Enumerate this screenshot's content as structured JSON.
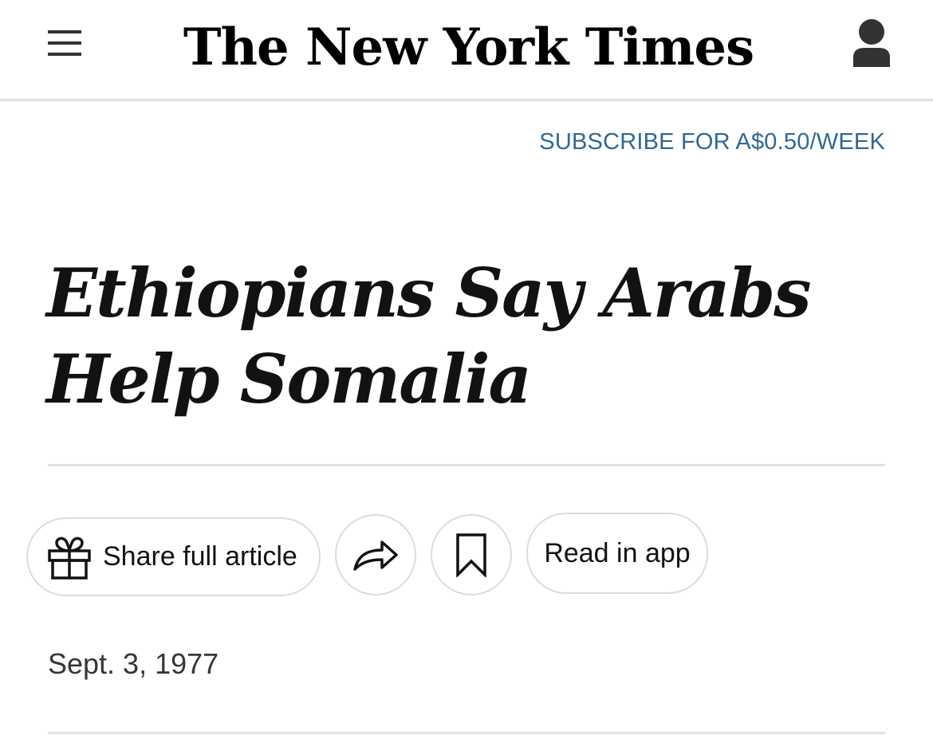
{
  "header": {
    "logo_text": "The New York Times",
    "menu_icon": "hamburger-menu-icon",
    "account_icon": "user-account-icon"
  },
  "subscribe": {
    "label": "SUBSCRIBE FOR A$0.50/WEEK",
    "color": "#326891"
  },
  "article": {
    "headline": "Ethiopians Say Arabs Help Somalia",
    "date": "Sept. 3, 1977"
  },
  "actions": {
    "share_full_article": "Share full article",
    "share_icon": "share-arrow-icon",
    "save_icon": "bookmark-icon",
    "gift_icon": "gift-icon",
    "read_in_app": "Read in app"
  }
}
